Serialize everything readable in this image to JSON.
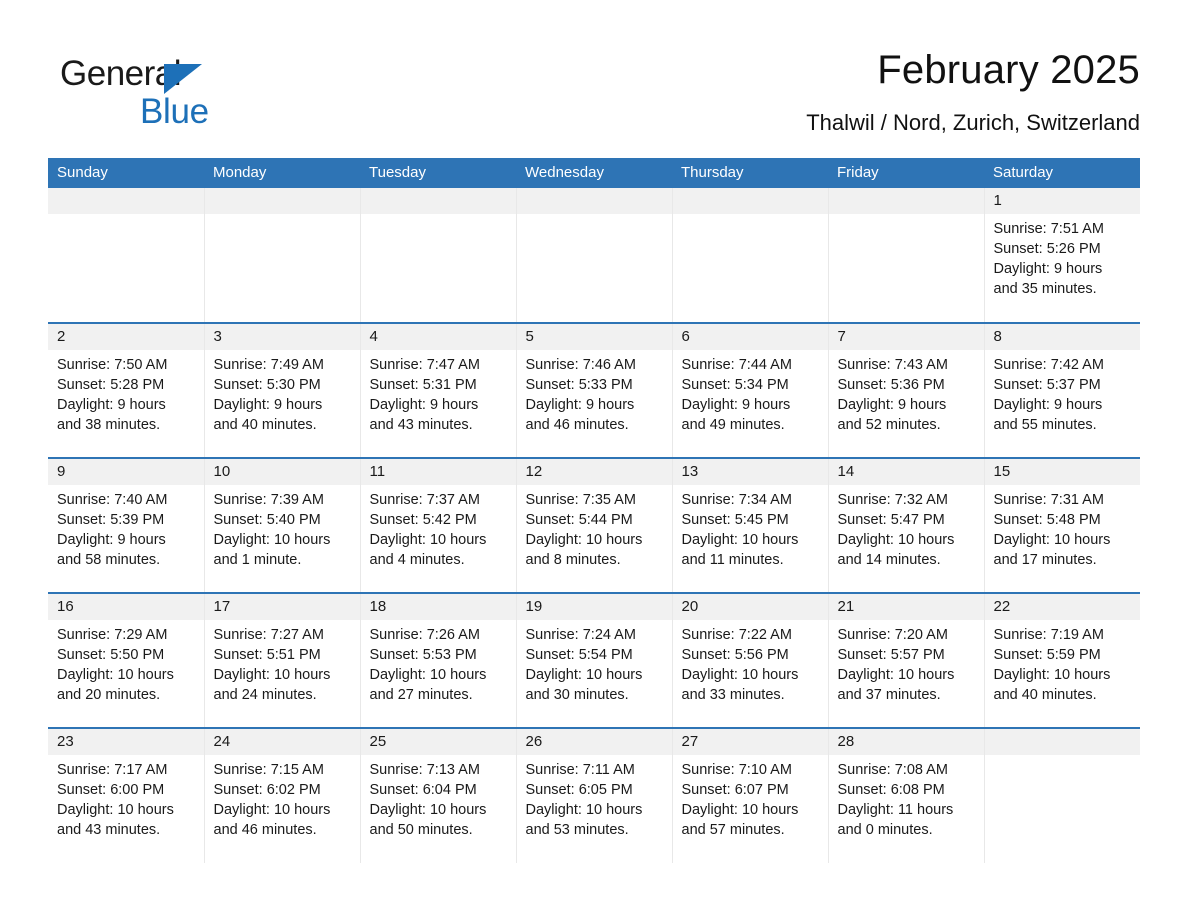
{
  "logo": {
    "word1": "General",
    "word2": "Blue",
    "triangle_color": "#1d70b8"
  },
  "header": {
    "title": "February 2025",
    "subtitle": "Thalwil / Nord, Zurich, Switzerland"
  },
  "theme": {
    "header_blue": "#2e74b5",
    "row_rule_blue": "#2e74b5",
    "daynum_band": "#f1f1f1",
    "text": "#1a1a1a"
  },
  "weekday_headers": [
    "Sunday",
    "Monday",
    "Tuesday",
    "Wednesday",
    "Thursday",
    "Friday",
    "Saturday"
  ],
  "weeks": [
    [
      {
        "day": "",
        "empty": true
      },
      {
        "day": "",
        "empty": true
      },
      {
        "day": "",
        "empty": true
      },
      {
        "day": "",
        "empty": true
      },
      {
        "day": "",
        "empty": true
      },
      {
        "day": "",
        "empty": true
      },
      {
        "day": "1",
        "sunrise": "Sunrise: 7:51 AM",
        "sunset": "Sunset: 5:26 PM",
        "daylight1": "Daylight: 9 hours",
        "daylight2": "and 35 minutes."
      }
    ],
    [
      {
        "day": "2",
        "sunrise": "Sunrise: 7:50 AM",
        "sunset": "Sunset: 5:28 PM",
        "daylight1": "Daylight: 9 hours",
        "daylight2": "and 38 minutes."
      },
      {
        "day": "3",
        "sunrise": "Sunrise: 7:49 AM",
        "sunset": "Sunset: 5:30 PM",
        "daylight1": "Daylight: 9 hours",
        "daylight2": "and 40 minutes."
      },
      {
        "day": "4",
        "sunrise": "Sunrise: 7:47 AM",
        "sunset": "Sunset: 5:31 PM",
        "daylight1": "Daylight: 9 hours",
        "daylight2": "and 43 minutes."
      },
      {
        "day": "5",
        "sunrise": "Sunrise: 7:46 AM",
        "sunset": "Sunset: 5:33 PM",
        "daylight1": "Daylight: 9 hours",
        "daylight2": "and 46 minutes."
      },
      {
        "day": "6",
        "sunrise": "Sunrise: 7:44 AM",
        "sunset": "Sunset: 5:34 PM",
        "daylight1": "Daylight: 9 hours",
        "daylight2": "and 49 minutes."
      },
      {
        "day": "7",
        "sunrise": "Sunrise: 7:43 AM",
        "sunset": "Sunset: 5:36 PM",
        "daylight1": "Daylight: 9 hours",
        "daylight2": "and 52 minutes."
      },
      {
        "day": "8",
        "sunrise": "Sunrise: 7:42 AM",
        "sunset": "Sunset: 5:37 PM",
        "daylight1": "Daylight: 9 hours",
        "daylight2": "and 55 minutes."
      }
    ],
    [
      {
        "day": "9",
        "sunrise": "Sunrise: 7:40 AM",
        "sunset": "Sunset: 5:39 PM",
        "daylight1": "Daylight: 9 hours",
        "daylight2": "and 58 minutes."
      },
      {
        "day": "10",
        "sunrise": "Sunrise: 7:39 AM",
        "sunset": "Sunset: 5:40 PM",
        "daylight1": "Daylight: 10 hours",
        "daylight2": "and 1 minute."
      },
      {
        "day": "11",
        "sunrise": "Sunrise: 7:37 AM",
        "sunset": "Sunset: 5:42 PM",
        "daylight1": "Daylight: 10 hours",
        "daylight2": "and 4 minutes."
      },
      {
        "day": "12",
        "sunrise": "Sunrise: 7:35 AM",
        "sunset": "Sunset: 5:44 PM",
        "daylight1": "Daylight: 10 hours",
        "daylight2": "and 8 minutes."
      },
      {
        "day": "13",
        "sunrise": "Sunrise: 7:34 AM",
        "sunset": "Sunset: 5:45 PM",
        "daylight1": "Daylight: 10 hours",
        "daylight2": "and 11 minutes."
      },
      {
        "day": "14",
        "sunrise": "Sunrise: 7:32 AM",
        "sunset": "Sunset: 5:47 PM",
        "daylight1": "Daylight: 10 hours",
        "daylight2": "and 14 minutes."
      },
      {
        "day": "15",
        "sunrise": "Sunrise: 7:31 AM",
        "sunset": "Sunset: 5:48 PM",
        "daylight1": "Daylight: 10 hours",
        "daylight2": "and 17 minutes."
      }
    ],
    [
      {
        "day": "16",
        "sunrise": "Sunrise: 7:29 AM",
        "sunset": "Sunset: 5:50 PM",
        "daylight1": "Daylight: 10 hours",
        "daylight2": "and 20 minutes."
      },
      {
        "day": "17",
        "sunrise": "Sunrise: 7:27 AM",
        "sunset": "Sunset: 5:51 PM",
        "daylight1": "Daylight: 10 hours",
        "daylight2": "and 24 minutes."
      },
      {
        "day": "18",
        "sunrise": "Sunrise: 7:26 AM",
        "sunset": "Sunset: 5:53 PM",
        "daylight1": "Daylight: 10 hours",
        "daylight2": "and 27 minutes."
      },
      {
        "day": "19",
        "sunrise": "Sunrise: 7:24 AM",
        "sunset": "Sunset: 5:54 PM",
        "daylight1": "Daylight: 10 hours",
        "daylight2": "and 30 minutes."
      },
      {
        "day": "20",
        "sunrise": "Sunrise: 7:22 AM",
        "sunset": "Sunset: 5:56 PM",
        "daylight1": "Daylight: 10 hours",
        "daylight2": "and 33 minutes."
      },
      {
        "day": "21",
        "sunrise": "Sunrise: 7:20 AM",
        "sunset": "Sunset: 5:57 PM",
        "daylight1": "Daylight: 10 hours",
        "daylight2": "and 37 minutes."
      },
      {
        "day": "22",
        "sunrise": "Sunrise: 7:19 AM",
        "sunset": "Sunset: 5:59 PM",
        "daylight1": "Daylight: 10 hours",
        "daylight2": "and 40 minutes."
      }
    ],
    [
      {
        "day": "23",
        "sunrise": "Sunrise: 7:17 AM",
        "sunset": "Sunset: 6:00 PM",
        "daylight1": "Daylight: 10 hours",
        "daylight2": "and 43 minutes."
      },
      {
        "day": "24",
        "sunrise": "Sunrise: 7:15 AM",
        "sunset": "Sunset: 6:02 PM",
        "daylight1": "Daylight: 10 hours",
        "daylight2": "and 46 minutes."
      },
      {
        "day": "25",
        "sunrise": "Sunrise: 7:13 AM",
        "sunset": "Sunset: 6:04 PM",
        "daylight1": "Daylight: 10 hours",
        "daylight2": "and 50 minutes."
      },
      {
        "day": "26",
        "sunrise": "Sunrise: 7:11 AM",
        "sunset": "Sunset: 6:05 PM",
        "daylight1": "Daylight: 10 hours",
        "daylight2": "and 53 minutes."
      },
      {
        "day": "27",
        "sunrise": "Sunrise: 7:10 AM",
        "sunset": "Sunset: 6:07 PM",
        "daylight1": "Daylight: 10 hours",
        "daylight2": "and 57 minutes."
      },
      {
        "day": "28",
        "sunrise": "Sunrise: 7:08 AM",
        "sunset": "Sunset: 6:08 PM",
        "daylight1": "Daylight: 11 hours",
        "daylight2": "and 0 minutes."
      },
      {
        "day": "",
        "empty": true
      }
    ]
  ]
}
